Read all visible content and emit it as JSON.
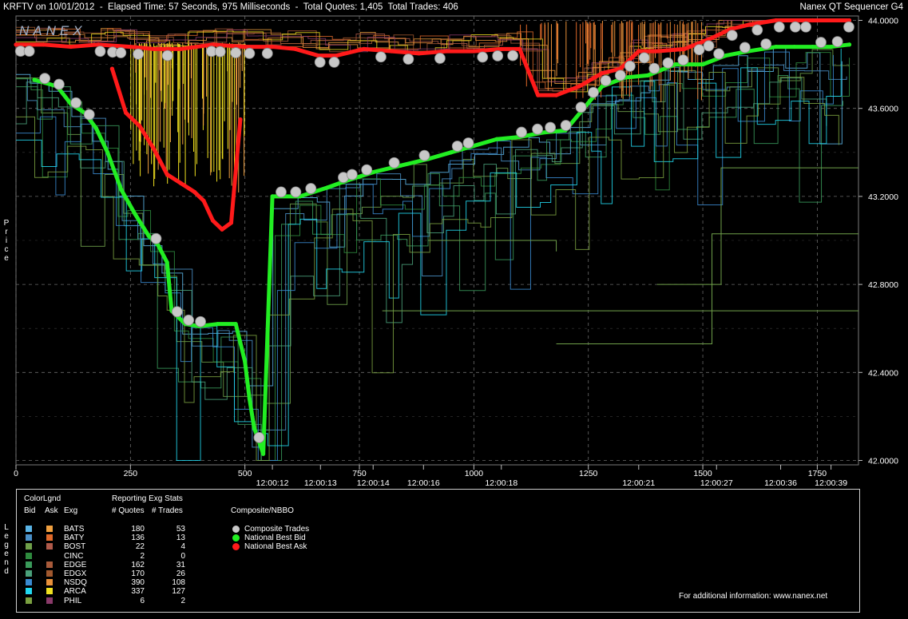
{
  "window": {
    "title": "KRFTV on 10/01/2012  -  Elapsed Time: 57 Seconds, 975 Milliseconds  -  Total Quotes: 1,405  Total Trades: 406",
    "app_name": "Nanex QT Sequencer G4",
    "watermark": "NANEX",
    "price_side_label": "Price",
    "legend_side_label": "Legend"
  },
  "colors": {
    "background": "#000000",
    "grid": "#6a6a6a",
    "national_best_bid": "#22ee22",
    "national_best_ask": "#ff1a1a",
    "composite_trades": "#c8c8c8"
  },
  "chart_data": {
    "type": "line",
    "x_axis": {
      "range": [
        0,
        1840
      ],
      "ticks": [
        0,
        250,
        500,
        750,
        1000,
        1250,
        1500,
        1750
      ],
      "time_labels": [
        {
          "seq": 560,
          "label": "12:00:12"
        },
        {
          "seq": 665,
          "label": "12:00:13"
        },
        {
          "seq": 780,
          "label": "12:00:14"
        },
        {
          "seq": 890,
          "label": "12:00:16"
        },
        {
          "seq": 1060,
          "label": "12:00:18"
        },
        {
          "seq": 1360,
          "label": "12:00:21"
        },
        {
          "seq": 1530,
          "label": "12:00:27"
        },
        {
          "seq": 1670,
          "label": "12:00:36"
        },
        {
          "seq": 1780,
          "label": "12:00:39"
        }
      ]
    },
    "y_axis": {
      "range": [
        41.98,
        44.02
      ],
      "ticks": [
        "42.0000",
        "42.4000",
        "42.8000",
        "43.2000",
        "43.6000",
        "44.0000"
      ],
      "grid": true
    },
    "series": [
      {
        "name": "National Best Ask",
        "color": "#ff1a1a",
        "points": [
          [
            0,
            43.89
          ],
          [
            60,
            43.89
          ],
          [
            120,
            43.88
          ],
          [
            180,
            43.89
          ],
          [
            250,
            43.88
          ],
          [
            300,
            43.87
          ],
          [
            360,
            43.87
          ],
          [
            430,
            43.89
          ],
          [
            500,
            43.88
          ],
          [
            560,
            43.88
          ],
          [
            610,
            43.87
          ],
          [
            660,
            43.84
          ],
          [
            700,
            43.84
          ],
          [
            760,
            43.87
          ],
          [
            820,
            43.86
          ],
          [
            880,
            43.85
          ],
          [
            940,
            43.86
          ],
          [
            1000,
            43.86
          ],
          [
            1060,
            43.87
          ],
          [
            1100,
            43.87
          ],
          [
            1140,
            43.66
          ],
          [
            1180,
            43.66
          ],
          [
            1230,
            43.7
          ],
          [
            1280,
            43.76
          ],
          [
            1320,
            43.78
          ],
          [
            1360,
            43.86
          ],
          [
            1400,
            43.86
          ],
          [
            1460,
            43.87
          ],
          [
            1520,
            43.92
          ],
          [
            1560,
            43.96
          ],
          [
            1600,
            43.98
          ],
          [
            1660,
            44.0
          ],
          [
            1740,
            44.0
          ],
          [
            1820,
            44.0
          ]
        ]
      },
      {
        "name": "National Best Ask",
        "color": "#ff1a1a",
        "points": [
          [
            210,
            43.78
          ],
          [
            240,
            43.58
          ],
          [
            270,
            43.52
          ],
          [
            300,
            43.42
          ],
          [
            330,
            43.3
          ],
          [
            360,
            43.26
          ],
          [
            390,
            43.22
          ],
          [
            410,
            43.18
          ],
          [
            430,
            43.09
          ],
          [
            450,
            43.05
          ],
          [
            470,
            43.08
          ],
          [
            490,
            43.55
          ]
        ]
      },
      {
        "name": "National Best Bid",
        "color": "#22ee22",
        "points": [
          [
            40,
            43.73
          ],
          [
            90,
            43.7
          ],
          [
            120,
            43.62
          ],
          [
            150,
            43.58
          ],
          [
            175,
            43.51
          ],
          [
            200,
            43.4
          ],
          [
            230,
            43.23
          ],
          [
            260,
            43.12
          ],
          [
            290,
            43.02
          ],
          [
            310,
            42.98
          ],
          [
            330,
            42.9
          ],
          [
            340,
            42.68
          ],
          [
            370,
            42.62
          ],
          [
            400,
            42.61
          ],
          [
            440,
            42.62
          ],
          [
            480,
            42.62
          ],
          [
            500,
            42.45
          ],
          [
            510,
            42.28
          ],
          [
            520,
            42.15
          ],
          [
            540,
            42.03
          ],
          [
            560,
            43.2
          ],
          [
            620,
            43.2
          ],
          [
            680,
            43.24
          ],
          [
            720,
            43.27
          ],
          [
            780,
            43.31
          ],
          [
            840,
            43.34
          ],
          [
            900,
            43.37
          ],
          [
            950,
            43.4
          ],
          [
            1000,
            43.43
          ],
          [
            1050,
            43.46
          ],
          [
            1100,
            43.47
          ],
          [
            1150,
            43.49
          ],
          [
            1200,
            43.5
          ],
          [
            1280,
            43.7
          ],
          [
            1330,
            43.74
          ],
          [
            1380,
            43.75
          ],
          [
            1440,
            43.8
          ],
          [
            1500,
            43.8
          ],
          [
            1550,
            43.84
          ],
          [
            1600,
            43.86
          ],
          [
            1660,
            43.88
          ],
          [
            1700,
            43.88
          ],
          [
            1740,
            43.88
          ],
          [
            1780,
            43.88
          ],
          [
            1820,
            43.89
          ]
        ]
      }
    ],
    "legend": {
      "header": {
        "title": "ColorLgnd",
        "stats_title": "Reporting Exg Stats",
        "bid": "Bid",
        "ask": "Ask",
        "exg": "Exg",
        "quotes": "# Quotes",
        "trades": "# Trades",
        "nbbo_title": "Composite/NBBO"
      },
      "exchanges": [
        {
          "exg": "BATS",
          "quotes": "180",
          "trades": "53",
          "bid_color": "#5ab4e6",
          "ask_color": "#f0a040"
        },
        {
          "exg": "BATY",
          "quotes": "136",
          "trades": "13",
          "bid_color": "#4a90c8",
          "ask_color": "#e06a2a"
        },
        {
          "exg": "BOST",
          "quotes": "22",
          "trades": "4",
          "bid_color": "#6fa04a",
          "ask_color": "#b05a4a"
        },
        {
          "exg": "CINC",
          "quotes": "2",
          "trades": "0",
          "bid_color": "#2e8a3e",
          "ask_color": "#000000"
        },
        {
          "exg": "EDGE",
          "quotes": "162",
          "trades": "31",
          "bid_color": "#3a9a5a",
          "ask_color": "#a85a3a"
        },
        {
          "exg": "EDGX",
          "quotes": "170",
          "trades": "26",
          "bid_color": "#4aa07a",
          "ask_color": "#a0582e"
        },
        {
          "exg": "NSDQ",
          "quotes": "390",
          "trades": "108",
          "bid_color": "#3a8ad0",
          "ask_color": "#e8903a"
        },
        {
          "exg": "ARCA",
          "quotes": "337",
          "trades": "127",
          "bid_color": "#22d8f0",
          "ask_color": "#f0e020"
        },
        {
          "exg": "PHIL",
          "quotes": "6",
          "trades": "2",
          "bid_color": "#7aa040",
          "ask_color": "#8a3a6a"
        }
      ],
      "nbbo": [
        {
          "label": "Composite Trades",
          "color": "#c8c8c8"
        },
        {
          "label": "National Best Bid",
          "color": "#22ee22"
        },
        {
          "label": "National Best Ask",
          "color": "#ff1a1a"
        }
      ],
      "footer": "For additional information: www.nanex.net"
    }
  }
}
